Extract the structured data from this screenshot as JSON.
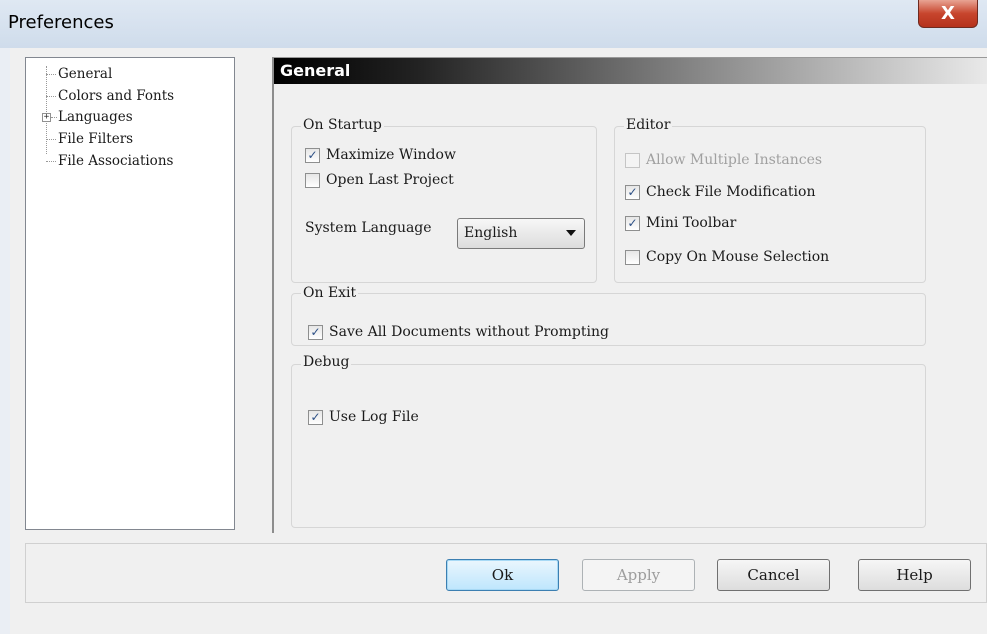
{
  "window": {
    "title": "Preferences",
    "close_glyph": "X"
  },
  "tree": {
    "items": [
      {
        "label": "General",
        "has_children": false
      },
      {
        "label": "Colors and Fonts",
        "has_children": false
      },
      {
        "label": "Languages",
        "has_children": true,
        "expander_glyph": "+"
      },
      {
        "label": "File Filters",
        "has_children": false
      },
      {
        "label": "File Associations",
        "has_children": false
      }
    ]
  },
  "panel": {
    "header": "General"
  },
  "on_startup": {
    "label": "On Startup",
    "maximize_window": {
      "label": "Maximize Window",
      "checked": true
    },
    "open_last_project": {
      "label": "Open Last Project",
      "checked": false
    },
    "system_language_label": "System Language",
    "system_language_value": "English"
  },
  "editor": {
    "label": "Editor",
    "allow_multiple_instances": {
      "label": "Allow Multiple Instances",
      "checked": false,
      "disabled": true
    },
    "check_file_modification": {
      "label": "Check File Modification",
      "checked": true
    },
    "mini_toolbar": {
      "label": "Mini Toolbar",
      "checked": true
    },
    "copy_on_mouse_selection": {
      "label": "Copy On Mouse Selection",
      "checked": false
    }
  },
  "on_exit": {
    "label": "On Exit",
    "save_all": {
      "label": "Save All Documents without Prompting",
      "checked": true
    }
  },
  "debug": {
    "label": "Debug",
    "use_log_file": {
      "label": "Use Log File",
      "checked": true
    }
  },
  "buttons": {
    "ok": "Ok",
    "apply": "Apply",
    "cancel": "Cancel",
    "help": "Help"
  },
  "glyphs": {
    "check": "✓"
  },
  "colors": {
    "title_bar": "#dfe8f3",
    "close_button": "#c7452d",
    "header_bar": "#000000"
  }
}
